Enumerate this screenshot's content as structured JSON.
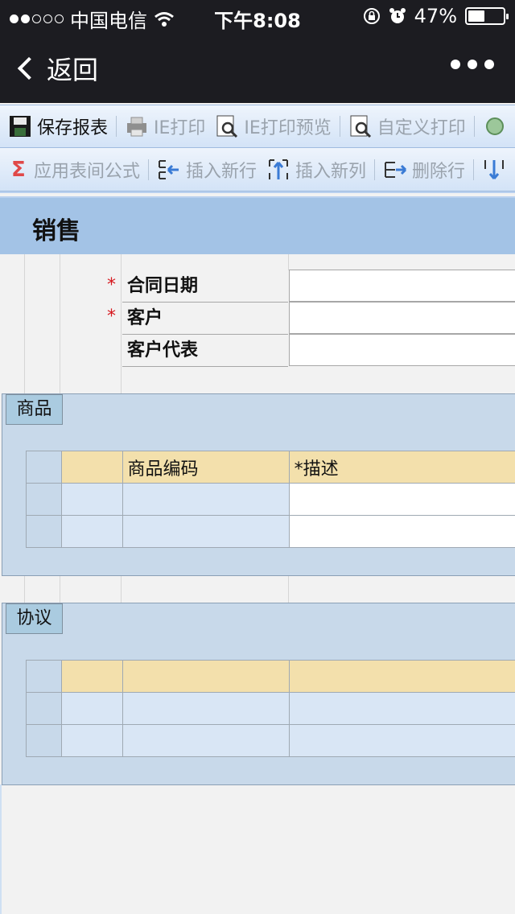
{
  "status_bar": {
    "carrier": "中国电信",
    "time": "下午8:08",
    "battery_percent": 47,
    "battery_label": "47%",
    "signal_dots_filled": 2,
    "signal_dots_total": 5
  },
  "nav": {
    "back_label": "返回"
  },
  "toolbar1": {
    "items": [
      {
        "label": "保存报表",
        "icon": "floppy-icon",
        "enabled": true
      },
      {
        "label": "IE打印",
        "icon": "printer-icon",
        "enabled": false
      },
      {
        "label": "IE打印预览",
        "icon": "print-preview-icon",
        "enabled": false
      },
      {
        "label": "自定义打印",
        "icon": "custom-print-icon",
        "enabled": false
      }
    ]
  },
  "toolbar2": {
    "items": [
      {
        "label": "应用表间公式",
        "icon": "sigma-icon"
      },
      {
        "label": "插入新行",
        "icon": "insert-row-icon"
      },
      {
        "label": "插入新列",
        "icon": "insert-column-icon"
      },
      {
        "label": "删除行",
        "icon": "delete-row-icon"
      }
    ]
  },
  "page": {
    "title": "销售"
  },
  "form": {
    "fields": [
      {
        "label": "合同日期",
        "required": true,
        "value": ""
      },
      {
        "label": "客户",
        "required": true,
        "value": ""
      },
      {
        "label": "客户代表",
        "required": false,
        "value": ""
      }
    ],
    "required_mark": "*"
  },
  "sections": {
    "products": {
      "tab_label": "商品",
      "headers": [
        "",
        "",
        "商品编码",
        "*描述"
      ]
    },
    "agreement": {
      "tab_label": "协议",
      "headers": [
        "",
        "",
        "",
        ""
      ]
    }
  },
  "colors": {
    "toolbar_bg": "#d3e3f7",
    "title_band": "#a3c3e6",
    "section_bg": "#c8d9ea",
    "header_cell": "#f3e0ac",
    "required": "#d6181e"
  }
}
